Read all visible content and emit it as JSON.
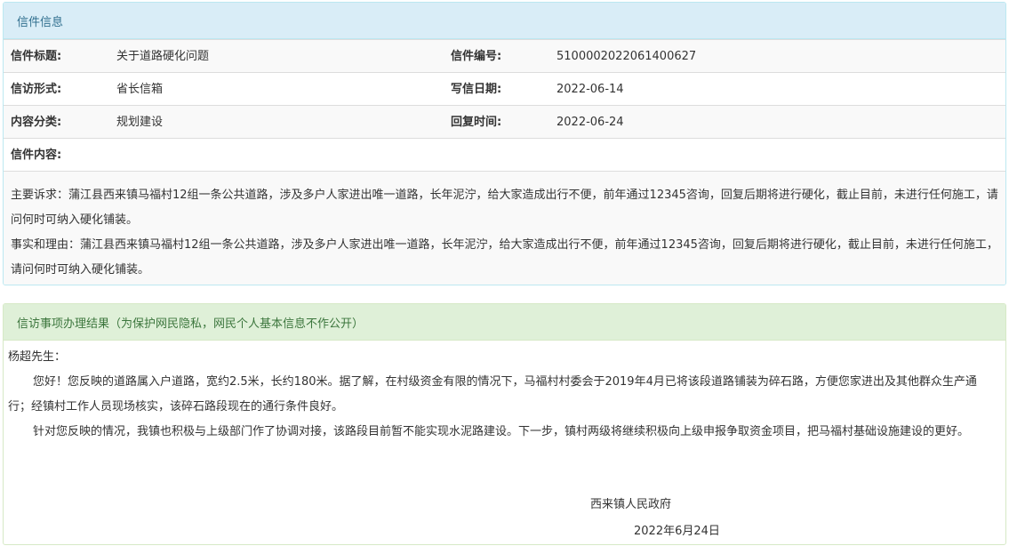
{
  "letter_info": {
    "header": "信件信息",
    "title_label": "信件标题:",
    "title_value": "关于道路硬化问题",
    "number_label": "信件编号:",
    "number_value": "5100002022061400627",
    "form_label": "信访形式:",
    "form_value": "省长信箱",
    "date_label": "写信日期:",
    "date_value": "2022-06-14",
    "category_label": "内容分类:",
    "category_value": "规划建设",
    "reply_time_label": "回复时间:",
    "reply_time_value": "2022-06-24",
    "content_label": "信件内容:",
    "content_paragraphs": [
      "主要诉求：蒲江县西来镇马福村12组一条公共道路，涉及多户人家进出唯一道路，长年泥泞，给大家造成出行不便，前年通过12345咨询，回复后期将进行硬化，截止目前，未进行任何施工，请问何时可纳入硬化铺装。",
      "事实和理由：蒲江县西来镇马福村12组一条公共道路，涉及多户人家进出唯一道路，长年泥泞，给大家造成出行不便，前年通过12345咨询，回复后期将进行硬化，截止目前，未进行任何施工，请问何时可纳入硬化铺装。"
    ]
  },
  "result": {
    "header": "信访事项办理结果（为保护网民隐私，网民个人基本信息不作公开）",
    "salutation": "杨超先生：",
    "paragraphs": [
      "您好！您反映的道路属入户道路，宽约2.5米，长约180米。据了解，在村级资金有限的情况下，马福村村委会于2019年4月已将该段道路铺装为碎石路，方便您家进出及其他群众生产通行；经镇村工作人员现场核实，该碎石路段现在的通行条件良好。",
      "针对您反映的情况，我镇也积极与上级部门作了协调对接，该路段目前暂不能实现水泥路建设。下一步，镇村两级将继续积极向上级申报争取资金项目，把马福村基础设施建设的更好。"
    ],
    "signature_org": "西来镇人民政府",
    "signature_date": "2022年6月24日"
  }
}
